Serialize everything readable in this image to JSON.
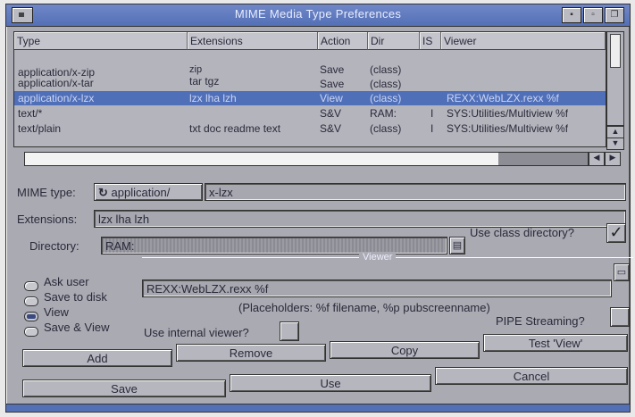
{
  "window": {
    "title": "MIME Media Type Preferences"
  },
  "list": {
    "headers": {
      "type": "Type",
      "extensions": "Extensions",
      "action": "Action",
      "dir": "Dir",
      "is": "IS",
      "viewer": "Viewer"
    },
    "rows": [
      {
        "type": "application/x-zip",
        "ext": "zip",
        "action": "Save",
        "dir": "(class)",
        "is": "",
        "viewer": ""
      },
      {
        "type": "application/x-tar",
        "ext": "tar tgz",
        "action": "Save",
        "dir": "(class)",
        "is": "",
        "viewer": ""
      },
      {
        "type": "application/x-lzx",
        "ext": "lzx lha lzh",
        "action": "View",
        "dir": "(class)",
        "is": "",
        "viewer": "REXX:WebLZX.rexx %f"
      },
      {
        "type": "text/*",
        "ext": "",
        "action": "S&V",
        "dir": "RAM:",
        "is": "I",
        "viewer": "SYS:Utilities/Multiview %f"
      },
      {
        "type": "text/plain",
        "ext": "txt doc readme text",
        "action": "S&V",
        "dir": "(class)",
        "is": "I",
        "viewer": "SYS:Utilities/Multiview %f"
      }
    ],
    "selected_index": 2
  },
  "form": {
    "mime_type_label": "MIME type:",
    "mime_class_value": "application/",
    "mime_subtype_value": "x-lzx",
    "extensions_label": "Extensions:",
    "extensions_value": "lzx lha lzh",
    "directory_label": "Directory:",
    "directory_value": "RAM:",
    "use_class_dir_label": "Use class directory?",
    "use_class_dir_checked": true
  },
  "action_radio": {
    "options": [
      "Ask user",
      "Save to disk",
      "View",
      "Save & View"
    ],
    "selected": "View"
  },
  "viewer": {
    "group_title": "Viewer",
    "command_value": "REXX:WebLZX.rexx %f",
    "placeholders_text": "(Placeholders: %f filename, %p pubscreenname)",
    "pipe_streaming_label": "PIPE Streaming?",
    "pipe_streaming_checked": false,
    "internal_viewer_label": "Use internal viewer?",
    "internal_viewer_checked": false
  },
  "buttons": {
    "add": "Add",
    "remove": "Remove",
    "copy": "Copy",
    "test_view": "Test 'View'",
    "save": "Save",
    "use": "Use",
    "cancel": "Cancel"
  },
  "icons": [
    "close-gadget",
    "depth-gadget",
    "zoom-gadget",
    "file-requester-icon",
    "cycle-icon",
    "drawer-requester-icon",
    "checkmark-icon"
  ],
  "colors": {
    "window_bg": "#a9aab2",
    "titlebar": "#5370b6",
    "selection": "#4f6fb8",
    "text": "#2a2a3a"
  }
}
